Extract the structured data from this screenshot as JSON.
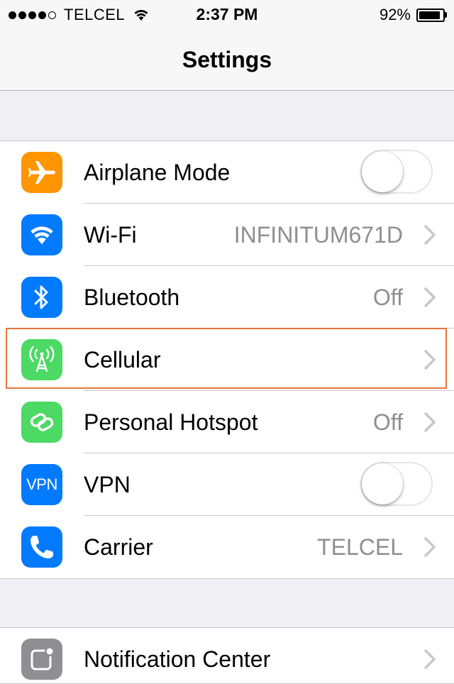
{
  "status_bar": {
    "carrier": "TELCEL",
    "time": "2:37 PM",
    "battery_percent": "92%",
    "battery_level": 0.92,
    "signal_bars_filled": 4,
    "signal_bars_total": 5
  },
  "nav": {
    "title": "Settings"
  },
  "group1": {
    "airplane": {
      "label": "Airplane Mode",
      "on": false,
      "icon": "airplane-icon",
      "color": "#ff9500"
    },
    "wifi": {
      "label": "Wi-Fi",
      "value": "INFINITUM671D",
      "icon": "wifi-icon",
      "color": "#007aff"
    },
    "bluetooth": {
      "label": "Bluetooth",
      "value": "Off",
      "icon": "bluetooth-icon",
      "color": "#007aff"
    },
    "cellular": {
      "label": "Cellular",
      "icon": "cellular-antenna-icon",
      "color": "#4cd964"
    },
    "hotspot": {
      "label": "Personal Hotspot",
      "value": "Off",
      "icon": "hotspot-icon",
      "color": "#4cd964"
    },
    "vpn": {
      "label": "VPN",
      "icon_text": "VPN",
      "on": false,
      "color": "#007aff"
    },
    "carrier": {
      "label": "Carrier",
      "value": "TELCEL",
      "icon": "phone-icon",
      "color": "#007aff"
    }
  },
  "group2": {
    "notification_center": {
      "label": "Notification Center",
      "icon": "notification-center-icon",
      "color": "#8e8e93"
    }
  },
  "highlight_color": "#e8753a"
}
